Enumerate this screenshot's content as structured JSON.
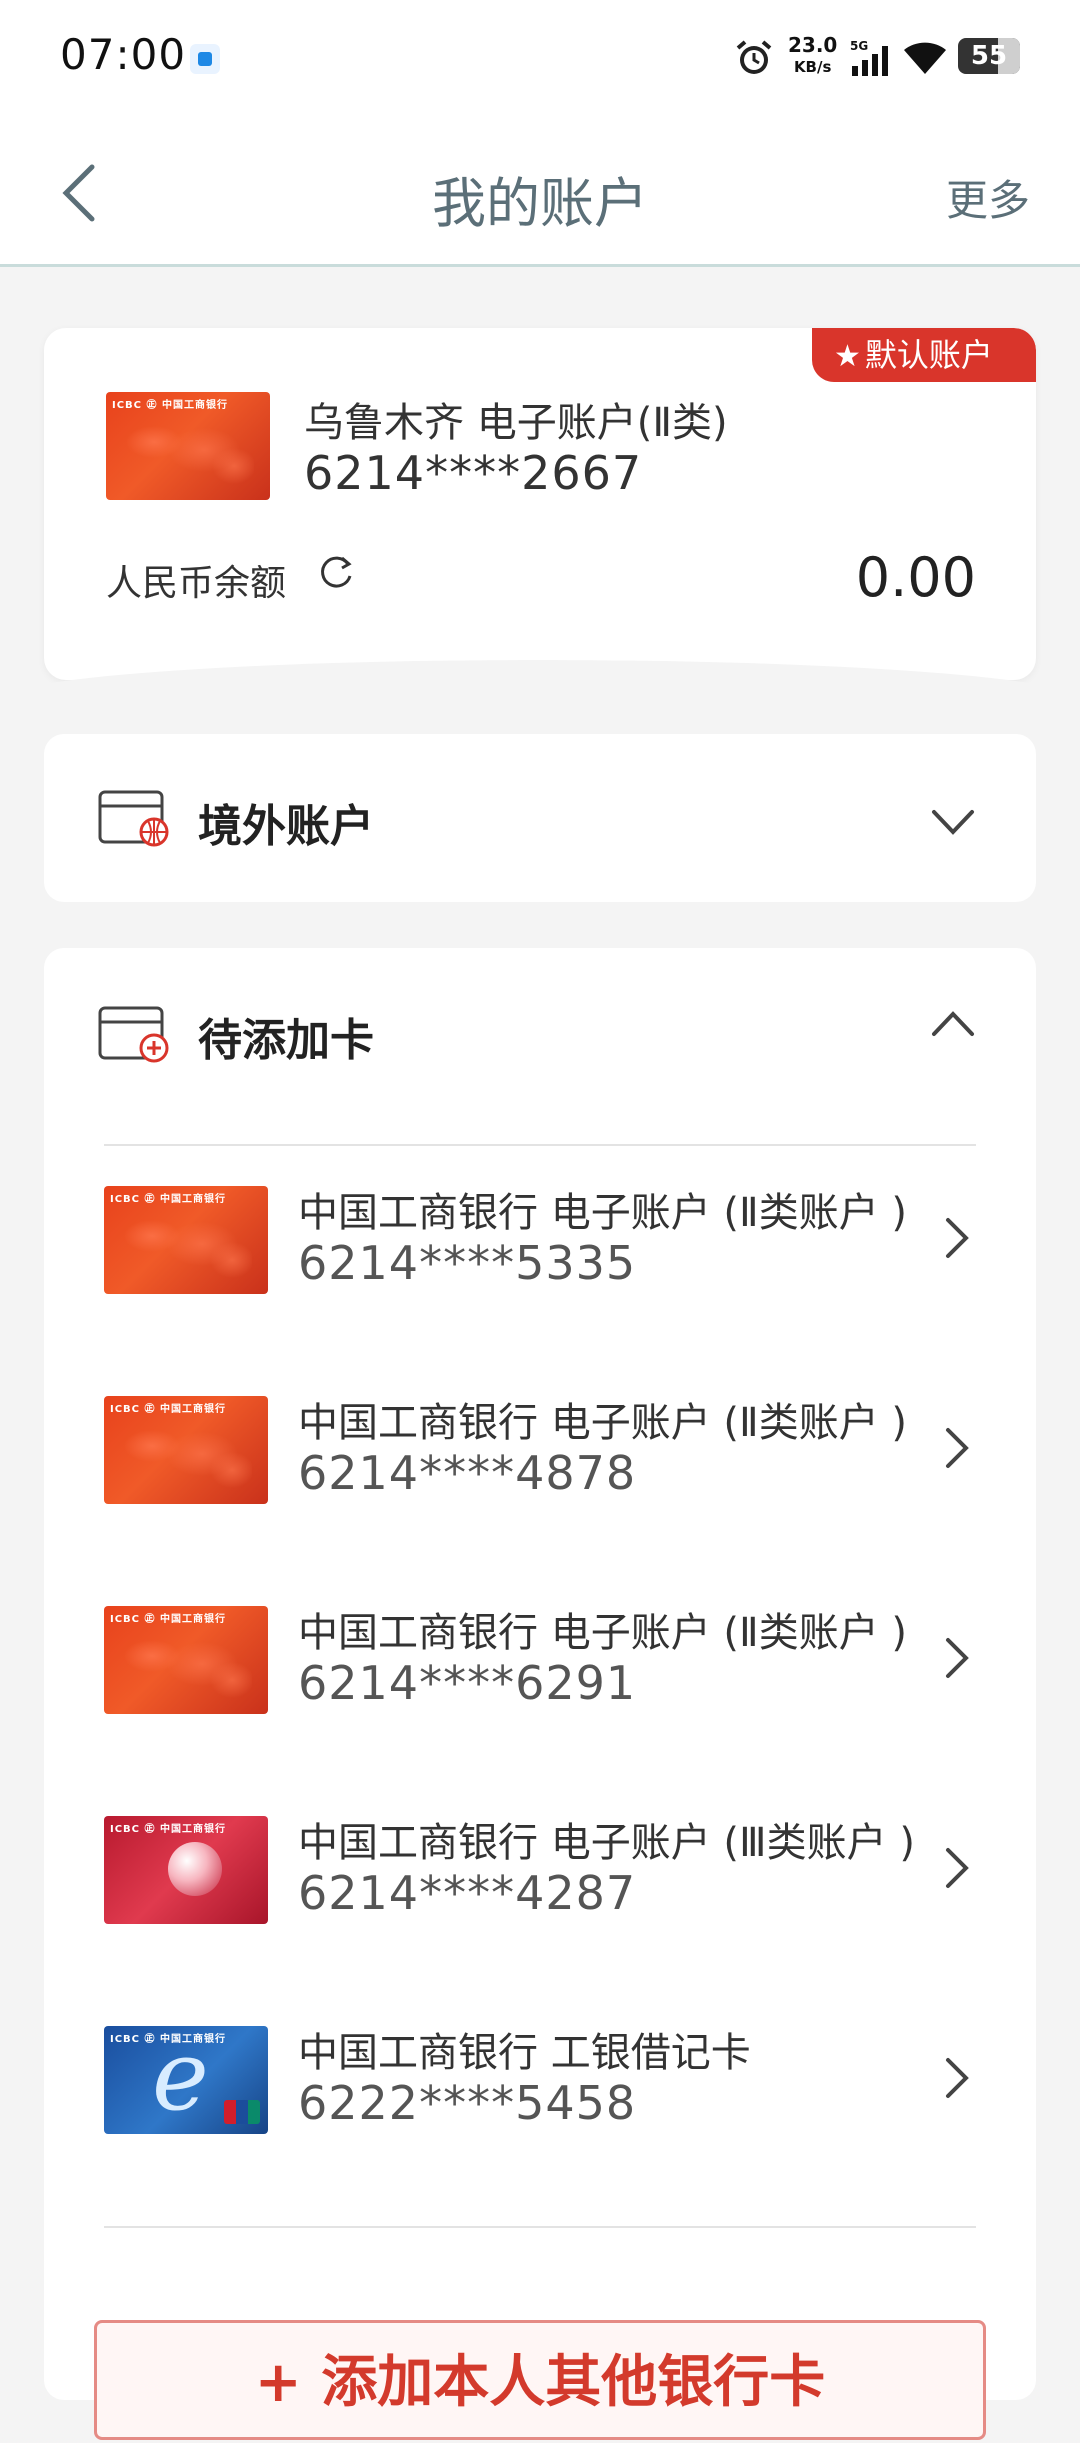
{
  "status_bar": {
    "time": "07:00",
    "network_speed": "23.0",
    "network_unit": "KB/s",
    "network_type": "5G",
    "battery": "55"
  },
  "header": {
    "title": "我的账户",
    "more": "更多"
  },
  "default_account": {
    "badge": "默认账户",
    "name": "乌鲁木齐 电子账户(Ⅱ类)",
    "number": "6214****2667",
    "balance_label": "人民币余额",
    "balance": "0.00",
    "card_brand": "ICBC ㊣ 中国工商银行"
  },
  "overseas": {
    "title": "境外账户"
  },
  "pending": {
    "title": "待添加卡",
    "cards": [
      {
        "name": "中国工商银行  电子账户 (Ⅱ类账户 )",
        "number": "6214****5335",
        "style": "red"
      },
      {
        "name": "中国工商银行  电子账户 (Ⅱ类账户 )",
        "number": "6214****4878",
        "style": "red"
      },
      {
        "name": "中国工商银行  电子账户 (Ⅱ类账户 )",
        "number": "6214****6291",
        "style": "red"
      },
      {
        "name": "中国工商银行  电子账户 (Ⅲ类账户 )",
        "number": "6214****4287",
        "style": "crimson"
      },
      {
        "name": "中国工商银行  工银借记卡",
        "number": "6222****5458",
        "style": "blue"
      }
    ],
    "add_button": "+ 添加本人其他银行卡"
  },
  "colors": {
    "accent_red": "#d9352b",
    "header_text": "#5b6f78"
  }
}
